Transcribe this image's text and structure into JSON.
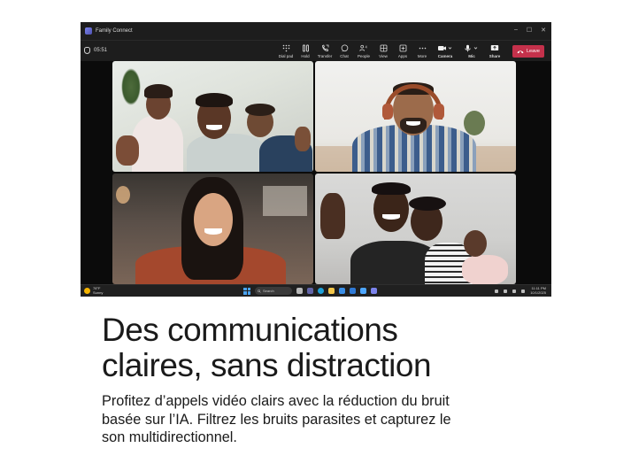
{
  "window": {
    "app_name": "Family Connect",
    "minimize": "–",
    "maximize": "☐",
    "close": "✕"
  },
  "call": {
    "timer": "05:51",
    "tools": [
      {
        "label": "Dial pad",
        "icon": "dialpad-icon"
      },
      {
        "label": "Hold",
        "icon": "hold-icon"
      },
      {
        "label": "Transfer",
        "icon": "transfer-icon"
      },
      {
        "label": "Chat",
        "icon": "chat-icon"
      },
      {
        "label": "People",
        "icon": "people-icon",
        "badge": "4"
      },
      {
        "label": "View",
        "icon": "view-icon"
      },
      {
        "label": "Apps",
        "icon": "apps-icon"
      },
      {
        "label": "More",
        "icon": "more-icon"
      },
      {
        "label": "Camera",
        "icon": "camera-icon"
      },
      {
        "label": "Mic",
        "icon": "mic-icon"
      },
      {
        "label": "Share",
        "icon": "share-icon"
      }
    ],
    "leave_label": "Leave",
    "leave_color": "#c4314b"
  },
  "taskbar": {
    "weather_temp": "78°F",
    "weather_desc": "Sunny",
    "search_placeholder": "Search",
    "time": "11:11 PM",
    "date": "10/1/2025"
  },
  "marketing": {
    "headline_line1": "Des communications",
    "headline_line2": "claires, sans distraction",
    "body_line1": "Profitez d’appels vidéo clairs avec la réduction du bruit",
    "body_line2": "basée sur l’IA. Filtrez les bruits parasites et capturez le",
    "body_line3": "son multidirectionnel."
  }
}
